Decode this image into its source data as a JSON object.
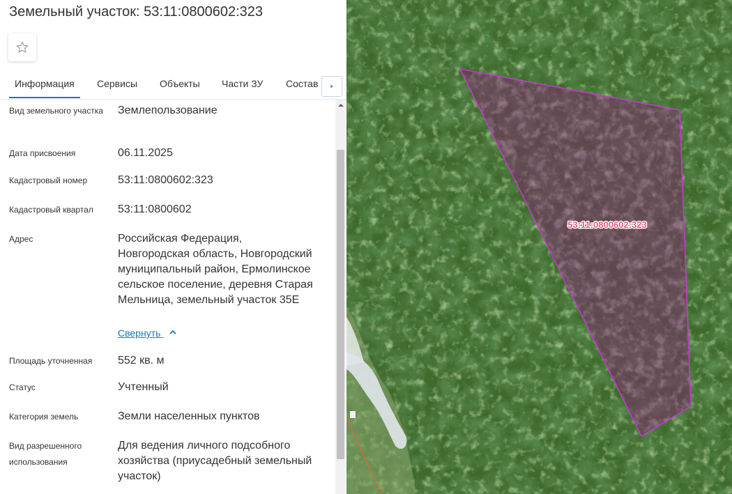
{
  "header": {
    "title": "Земельный участок: 53:11:0800602:323"
  },
  "tabs": [
    {
      "label": "Информация",
      "active": true
    },
    {
      "label": "Сервисы",
      "active": false
    },
    {
      "label": "Объекты",
      "active": false
    },
    {
      "label": "Части ЗУ",
      "active": false
    },
    {
      "label": "Состав",
      "active": false
    }
  ],
  "info": {
    "land_type_label": "Вид земельного участка",
    "land_type_value": "Землепользование",
    "date_label": "Дата присвоения",
    "date_value": "06.11.2025",
    "cadastral_number_label": "Кадастровый номер",
    "cadastral_number_value": "53:11:0800602:323",
    "cadastral_quarter_label": "Кадастровый квартал",
    "cadastral_quarter_value": "53:11:0800602",
    "address_label": "Адрес",
    "address_value": "Российская Федерация, Новгородская область, Новгородский муниципальный район, Ермолинское сельское поселение, деревня Старая Мельница, земельный участок 35Е",
    "collapse_label": "Свернуть",
    "area_label": "Площадь уточненная",
    "area_value": "552 кв. м",
    "status_label": "Статус",
    "status_value": "Учтенный",
    "category_label": "Категория земель",
    "category_value": "Земли населенных пунктов",
    "permitted_use_label": "Вид разрешенного использования",
    "permitted_use_value": "Для ведения личного подсобного хозяйства (приусадебный земельный участок)"
  },
  "map": {
    "parcel_label": "53:11:0800602:323",
    "parcel_fill": "#7a2a6a",
    "parcel_stroke": "#c23ad0",
    "label_color": "#e8607a"
  },
  "colors": {
    "accent": "#1a73c9",
    "text": "#333333"
  }
}
